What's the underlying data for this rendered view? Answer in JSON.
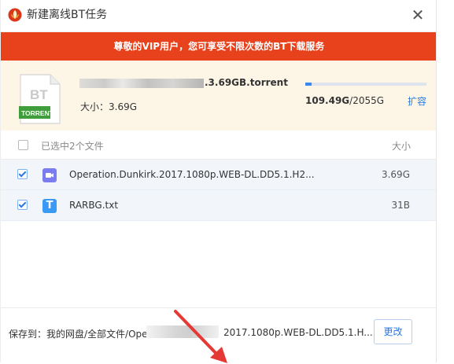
{
  "dialog": {
    "title": "新建离线BT任务",
    "close_glyph": "✕"
  },
  "banner": {
    "text": "尊敬的VIP用户，您可享受不限次数的BT下载服务"
  },
  "torrent": {
    "icon_text_top": "BT",
    "icon_text_bottom": "TORRENT",
    "name_visible": ".3.69GB.torrent",
    "size_label": "大小：3.69G",
    "quota_used": "109.49G",
    "quota_total": "/2055G",
    "quota_fraction": 0.053,
    "expand_label": "扩容"
  },
  "list": {
    "header_label": "已选中2个文件",
    "header_size": "大小",
    "files": [
      {
        "name": "Operation.Dunkirk.2017.1080p.WEB-DL.DD5.1.H2...",
        "size": "3.69G",
        "icon": "video-icon",
        "checked": true
      },
      {
        "name": "RARBG.txt",
        "size": "31B",
        "icon": "txt-icon",
        "icon_glyph": "T",
        "checked": true
      }
    ]
  },
  "footer": {
    "save_to_label": "保存到：我的网盘/全部文件/Operatic",
    "path_tail": "2017.1080p.WEB-DL.DD5.1.H...",
    "change_label": "更改"
  },
  "colors": {
    "banner_bg": "#e8421c",
    "accent": "#2a7ae2",
    "torrent_panel_bg": "#fdf6e7",
    "row_selected_bg": "#f2f6fb",
    "annotation_arrow": "#e53935"
  }
}
